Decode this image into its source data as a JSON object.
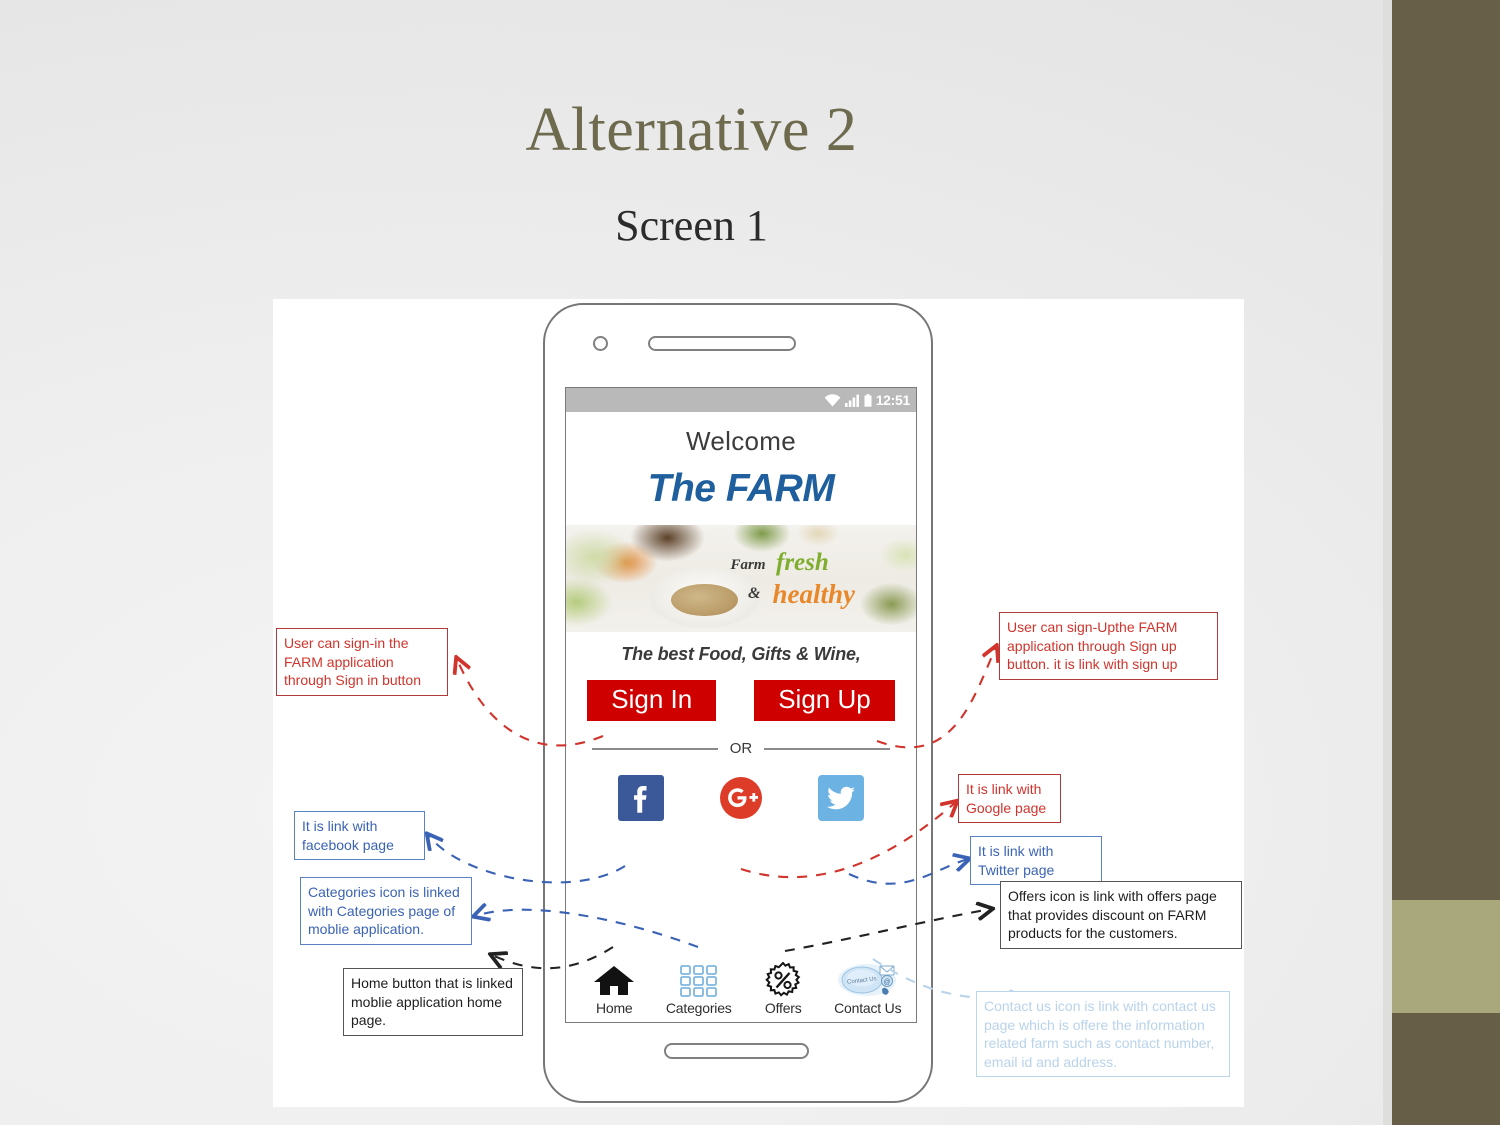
{
  "slide": {
    "title": "Alternative 2",
    "subtitle": "Screen 1",
    "title_color": "#6e6a4e",
    "subtitle_color": "#2b2b2b",
    "accent_bar_dark": "#665e47",
    "accent_bar_sage": "#a9a87d"
  },
  "phone": {
    "status_bar": {
      "time": "12:51",
      "wifi_icon": "wifi-icon",
      "signal_icon": "signal-bars-icon",
      "battery_icon": "battery-icon"
    },
    "welcome_text": "Welcome",
    "brand_text": "The FARM",
    "brand_color": "#1f5f9e",
    "banner": {
      "word_farm": "Farm",
      "word_fresh": "fresh",
      "word_amp": "&",
      "word_healthy": "healthy",
      "fresh_color": "#7fae2f",
      "healthy_color": "#e8882b"
    },
    "tagline": "The best Food, Gifts & Wine,",
    "buttons": {
      "sign_in": "Sign In",
      "sign_up": "Sign Up",
      "button_color": "#cf0000"
    },
    "divider_label": "OR",
    "social": [
      {
        "name": "facebook",
        "label": "Facebook",
        "color": "#3b5998"
      },
      {
        "name": "google-plus",
        "label": "Google+",
        "color": "#dc3c28"
      },
      {
        "name": "twitter",
        "label": "Twitter",
        "color": "#6cb2e2"
      }
    ],
    "nav": [
      {
        "icon": "home-icon",
        "label": "Home"
      },
      {
        "icon": "categories-grid-icon",
        "label": "Categories"
      },
      {
        "icon": "offers-percent-icon",
        "label": "Offers"
      },
      {
        "icon": "contact-us-icon",
        "label": "Contact Us"
      }
    ]
  },
  "annotations": {
    "sign_in": "User can sign-in the FARM application through Sign in button",
    "sign_up": "User can sign-Upthe  FARM application through Sign up button. it is link with sign up",
    "facebook": "It is link with facebook page",
    "google": "It is link with Google page",
    "twitter": "It is link with Twitter page",
    "categories": "Categories icon is linked with Categories page of moblie application.",
    "home": "Home button that is linked moblie application home page.",
    "offers": "Offers icon is link with offers page that  provides discount on FARM products for the customers.",
    "contact": "Contact us icon is link with contact us page which is offere the information related farm such as contact number, email id and address."
  }
}
